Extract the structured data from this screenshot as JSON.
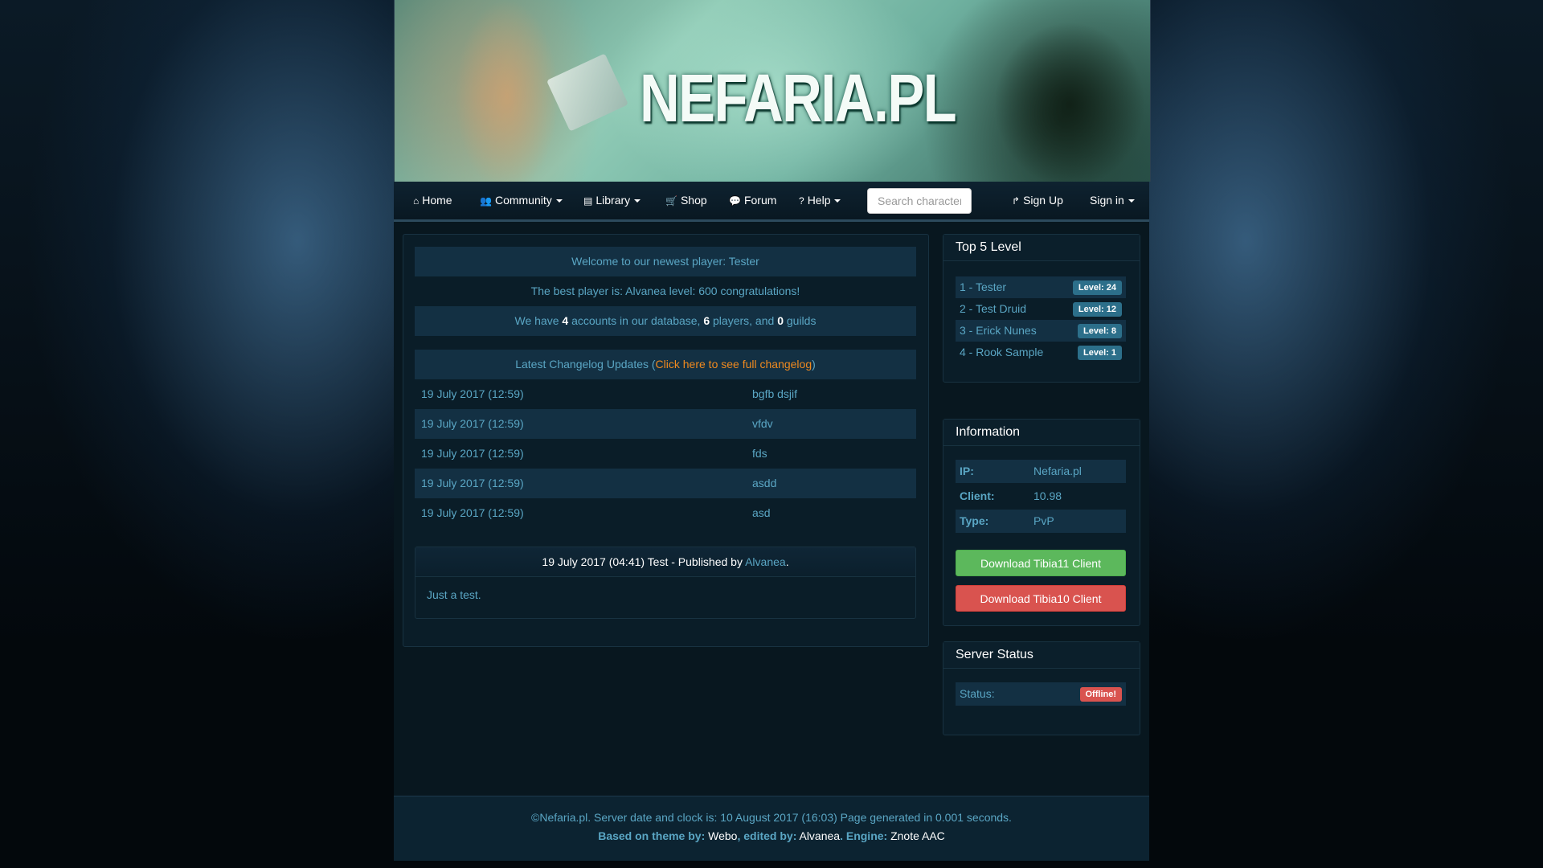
{
  "site": {
    "logo_text": "NEFARIA.PL"
  },
  "nav": {
    "home": "Home",
    "community": "Community",
    "library": "Library",
    "shop": "Shop",
    "forum": "Forum",
    "help": "Help",
    "search_placeholder": "Search character",
    "signup": "Sign Up",
    "signin": "Sign in"
  },
  "stats": {
    "newest_prefix": "Welcome to our newest player: ",
    "newest_player": "Tester",
    "best_prefix": "The best player is: ",
    "best_player": "Alvanea level: 600 congratulations!",
    "we_have": "We have ",
    "accounts_count": "4",
    "accounts_text": " accounts in our database, ",
    "players_count": "6",
    "players_text": " players, and ",
    "guilds_count": "0",
    "guilds_text": " guilds"
  },
  "changelog": {
    "title": "Latest Changelog Updates (",
    "link": "Click here to see full changelog",
    "close": ")",
    "rows": [
      {
        "date": "19 July 2017 (12:59)",
        "text": "bgfb dsjif"
      },
      {
        "date": "19 July 2017 (12:59)",
        "text": "vfdv"
      },
      {
        "date": "19 July 2017 (12:59)",
        "text": "fds"
      },
      {
        "date": "19 July 2017 (12:59)",
        "text": "asdd"
      },
      {
        "date": "19 July 2017 (12:59)",
        "text": "asd"
      }
    ]
  },
  "news": {
    "head": "19 July 2017 (04:41) Test - Published by ",
    "author": "Alvanea",
    "end": ".",
    "body": "Just a test."
  },
  "top5": {
    "title": "Top 5 Level",
    "rows": [
      {
        "name": "1 - Tester",
        "level": "Level: 24"
      },
      {
        "name": "2 - Test Druid",
        "level": "Level: 12"
      },
      {
        "name": "3 - Erick Nunes",
        "level": "Level: 8"
      },
      {
        "name": "4 - Rook Sample",
        "level": "Level: 1"
      }
    ]
  },
  "information": {
    "title": "Information",
    "rows": [
      {
        "key": "IP:",
        "value": "Nefaria.pl"
      },
      {
        "key": "Client:",
        "value": "10.98"
      },
      {
        "key": "Type:",
        "value": "PvP"
      }
    ],
    "download11": "Download Tibia11 Client",
    "download10": "Download Tibia10 Client"
  },
  "server_status": {
    "title": "Server Status",
    "label": "Status:",
    "value": "Offline!"
  },
  "footer": {
    "line1": "©Nefaria.pl. Server date and clock is: 10 August 2017 (16:03) Page generated in 0.001 seconds.",
    "based_label": "Based on theme by:",
    "based_value": "Webo",
    "edited_label": "edited by:",
    "edited_value": "Alvanea",
    "engine_label": "Engine:",
    "engine_value": "Znote AAC"
  },
  "colors": {
    "accent": "#5aa6c4",
    "link_orange": "#f08a1f",
    "btn_green": "#5cb85c",
    "btn_red": "#d9534f"
  }
}
